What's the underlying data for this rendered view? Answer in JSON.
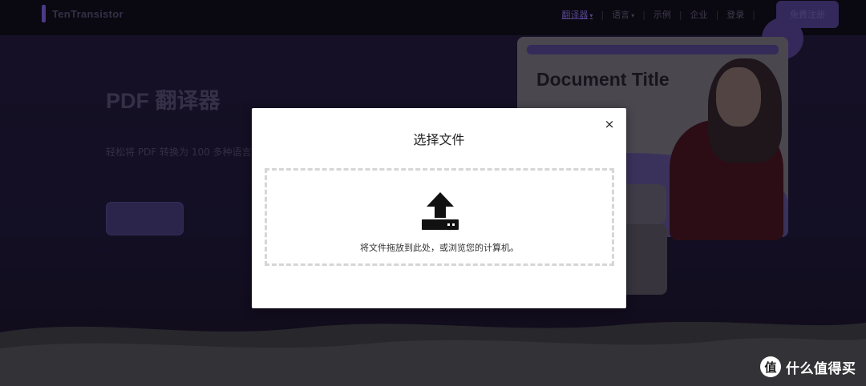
{
  "header": {
    "logo_text": "TenTransistor",
    "nav": [
      {
        "label": "翻译器",
        "has_caret": true,
        "active": true
      },
      {
        "label": "语言",
        "has_caret": true,
        "active": false
      },
      {
        "label": "示例",
        "has_caret": false,
        "active": false
      },
      {
        "label": "企业",
        "has_caret": false,
        "active": false
      },
      {
        "label": "登录",
        "has_caret": false,
        "active": false
      }
    ],
    "cta_label": "免费注册"
  },
  "hero": {
    "title": "PDF 翻译器",
    "subtitle": "轻松将 PDF 转换为 100 多种语言"
  },
  "preview": {
    "document_title": "Document Title"
  },
  "modal": {
    "title": "选择文件",
    "close_glyph": "×",
    "dropzone_text": "将文件拖放到此处，或浏览您的计算机。"
  },
  "watermark": {
    "badge": "值",
    "text": "什么值得买"
  },
  "colors": {
    "accent": "#6f56c9",
    "modal_bg": "#ffffff",
    "dropzone_border": "#d6d6d6"
  }
}
